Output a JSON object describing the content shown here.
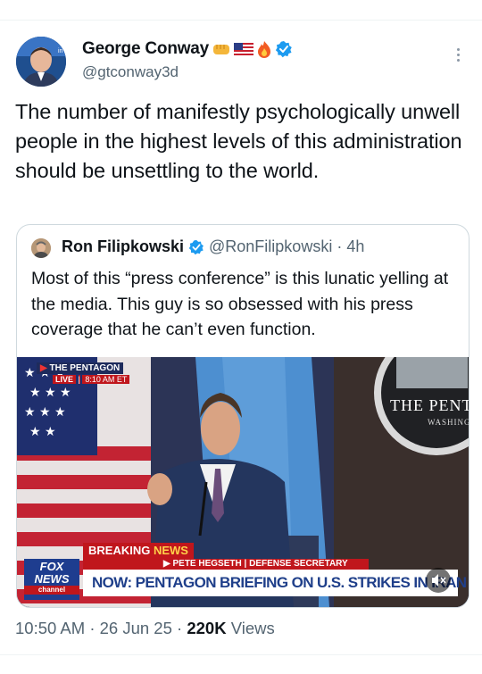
{
  "tweet": {
    "author_name": "George Conway",
    "author_handle": "@gtconway3d",
    "text": "The number of manifestly psychologically unwell people in the highest levels of this administration should be unsettling to the world.",
    "time": "10:50 AM",
    "date": "26 Jun 25",
    "views_count": "220K",
    "views_label": "Views",
    "separator": "·"
  },
  "quoted": {
    "author_name": "Ron Filipkowski",
    "author_handle": "@RonFilipkowski",
    "age": "4h",
    "separator": "·",
    "text": "Most of this “press conference” is this lunatic yelling at the media. This guy is so obsessed with his press coverage that he can’t even function."
  },
  "video": {
    "source_tag": "THE PENTAGON",
    "live_label": "LIVE",
    "live_time": "8:10 AM ET",
    "backdrop_title": "THE PENT",
    "backdrop_subtitle": "WASHING",
    "breaking_label": "BREAKING",
    "breaking_news_word": "NEWS",
    "lower_third_name": "PETE HEGSETH",
    "lower_third_role": "DEFENSE SECRETARY",
    "headline": "NOW: PENTAGON BRIEFING ON U.S. STRIKES IN IRAN",
    "network_line1": "FOX",
    "network_line2": "NEWS",
    "network_line3": "channel"
  },
  "colors": {
    "verified": "#1d9bf0",
    "text_primary": "#0f1419",
    "text_secondary": "#536471",
    "border": "#cfd9de",
    "breaking_red": "#c0161c",
    "headline_blue": "#1f3f8a"
  },
  "icons": [
    "verified-badge-icon",
    "fist-emoji-icon",
    "us-flag-emoji-icon",
    "fire-emoji-icon",
    "more-options-icon",
    "mute-icon"
  ]
}
